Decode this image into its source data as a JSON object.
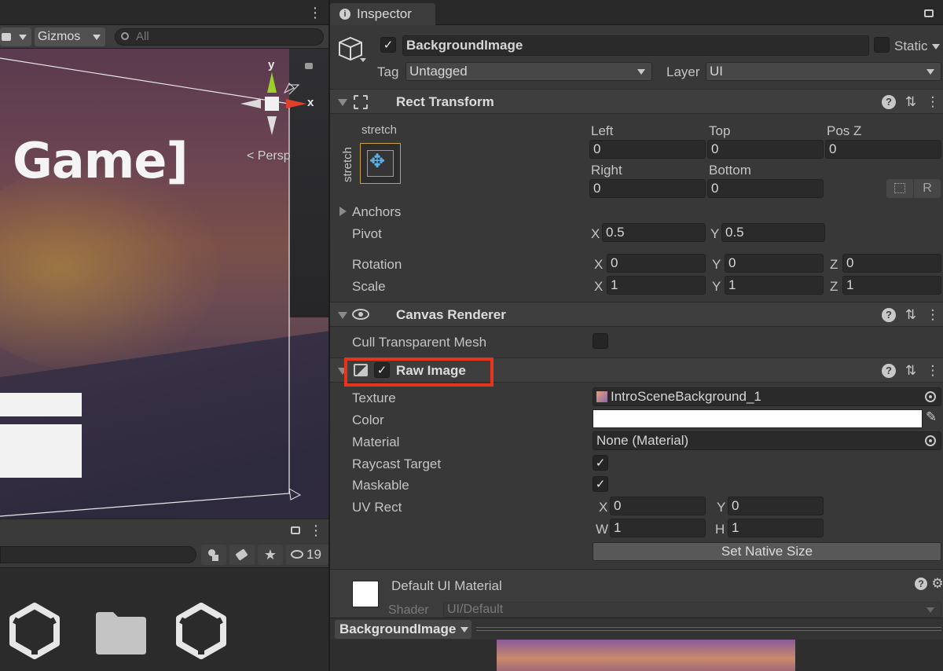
{
  "scene": {
    "toolbar": {
      "gizmos_label": "Gizmos",
      "search_placeholder": "All"
    },
    "game_text": "Game]",
    "persp_label": "< Persp",
    "gizmo_axis_y": "y",
    "gizmo_axis_x": "x"
  },
  "bottom_toolbar": {
    "hidden_count": "19"
  },
  "inspector": {
    "tab_label": "Inspector",
    "object": {
      "name": "BackgroundImage",
      "active": true,
      "static_label": "Static",
      "tag_label": "Tag",
      "tag_value": "Untagged",
      "layer_label": "Layer",
      "layer_value": "UI"
    },
    "rect_transform": {
      "title": "Rect Transform",
      "anchor_preset_top": "stretch",
      "anchor_preset_side": "stretch",
      "left_label": "Left",
      "left_value": "0",
      "top_label": "Top",
      "top_value": "0",
      "posz_label": "Pos Z",
      "posz_value": "0",
      "right_label": "Right",
      "right_value": "0",
      "bottom_label": "Bottom",
      "bottom_value": "0",
      "raw_edit_label": "R",
      "anchors_label": "Anchors",
      "pivot_label": "Pivot",
      "pivot_x_label": "X",
      "pivot_x": "0.5",
      "pivot_y_label": "Y",
      "pivot_y": "0.5",
      "rotation_label": "Rotation",
      "rot_x_label": "X",
      "rot_x": "0",
      "rot_y_label": "Y",
      "rot_y": "0",
      "rot_z_label": "Z",
      "rot_z": "0",
      "scale_label": "Scale",
      "scale_x_label": "X",
      "scale_x": "1",
      "scale_y_label": "Y",
      "scale_y": "1",
      "scale_z_label": "Z",
      "scale_z": "1"
    },
    "canvas_renderer": {
      "title": "Canvas Renderer",
      "cull_label": "Cull Transparent Mesh",
      "cull_checked": false
    },
    "raw_image": {
      "title": "Raw Image",
      "enabled": true,
      "highlight_color": "#e8341c",
      "texture_label": "Texture",
      "texture_value": "IntroSceneBackground_1",
      "color_label": "Color",
      "color_value": "#ffffff",
      "material_label": "Material",
      "material_value": "None (Material)",
      "raycast_label": "Raycast Target",
      "raycast_checked": true,
      "maskable_label": "Maskable",
      "maskable_checked": true,
      "uvrect_label": "UV Rect",
      "uv_x_label": "X",
      "uv_x": "0",
      "uv_y_label": "Y",
      "uv_y": "0",
      "uv_w_label": "W",
      "uv_w": "1",
      "uv_h_label": "H",
      "uv_h": "1",
      "native_size_button": "Set Native Size"
    },
    "material_section": {
      "title": "Default UI Material",
      "shader_label": "Shader",
      "shader_value": "UI/Default"
    },
    "preview": {
      "title": "BackgroundImage"
    }
  },
  "icons": {
    "help": "?",
    "settings": "⇅",
    "more": "⋮",
    "lock": "🔒",
    "check": "✓",
    "hidden": "👁"
  }
}
